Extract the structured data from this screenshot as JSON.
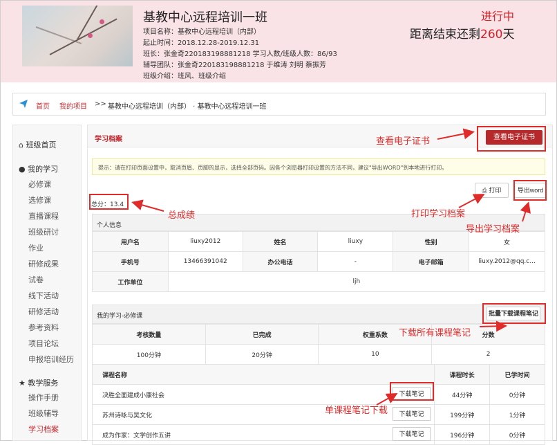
{
  "header": {
    "title": "基教中心远程培训一班",
    "project_name": "项目名称：基教中心远程培训（内部）",
    "period": "起止时间：2018.12.28-2019.12.31",
    "monitor_and_count": "班长：张金奇220183198881218      学习人数/班级人数：86/93",
    "tutors": "辅导团队：张金奇220183198881218      于维涛      刘明      蔡振芳",
    "class_intro": "班级介绍：班风、班级介绍",
    "status": "进行中",
    "countdown_prefix": "距离结束还剩",
    "countdown_days": "260",
    "countdown_suffix": "天"
  },
  "breadcrumb": {
    "home": "首页",
    "my_projects": "我的项目",
    "sep": ">>",
    "current": "基教中心远程培训（内部）  · 基教中心远程培训一班"
  },
  "sidebar": {
    "class_home": "班级首页",
    "my_study": "我的学习",
    "study_items": [
      "必修课",
      "选修课",
      "直播课程",
      "班级研讨",
      "作业",
      "研修成果",
      "试卷",
      "线下活动",
      "研修活动",
      "参考资料",
      "项目论坛",
      "申报培训经历"
    ],
    "teaching_service": "教学服务",
    "service_items": [
      "操作手册",
      "班级辅导",
      "学习档案"
    ]
  },
  "panel": {
    "title": "学习档案",
    "view_certificate": "查看电子证书",
    "tip": "提示：请在打印页面设置中，取消页眉、页脚的显示，选择全部页码。因各个浏览器打印设置的方法不同，建议\"导出WORD\"到本地进行打印。",
    "print": "打印",
    "export_word": "导出word",
    "total_score": "总分：13.4"
  },
  "personal": {
    "section_title": "个人信息",
    "labels": {
      "username": "用户名",
      "name": "姓名",
      "gender": "性别",
      "phone": "手机号",
      "office_phone": "办公电话",
      "email": "电子邮箱",
      "workplace": "工作单位"
    },
    "values": {
      "username": "liuxy2012",
      "name": "liuxy",
      "gender": "女",
      "phone": "13466391042",
      "office_phone": "-",
      "email": "liuxy.2012@qq.c...",
      "workplace": "ljh"
    }
  },
  "required": {
    "section_title": "我的学习-必修课",
    "bulk_download": "批量下载课程笔记",
    "headers": [
      "考核数量",
      "已完成",
      "权重系数",
      "分数"
    ],
    "values": [
      "100分钟",
      "20分钟",
      "10",
      "2"
    ],
    "course_headers": [
      "课程名称",
      "课程时长",
      "已学时间"
    ],
    "download_label": "下载笔记",
    "courses": [
      {
        "name": "决胜全面建成小康社会",
        "duration": "44分钟",
        "learned": "0分钟"
      },
      {
        "name": "苏州诗咏与吴文化",
        "duration": "199分钟",
        "learned": "1分钟"
      },
      {
        "name": "成为作家：文学创作五讲",
        "duration": "196分钟",
        "learned": "0分钟"
      }
    ]
  },
  "annotations": {
    "view_certificate": "查看电子证书",
    "total_score": "总成绩",
    "print_record": "打印学习档案",
    "export_record": "导出学习档案",
    "download_all_notes": "下载所有课程笔记",
    "single_note_download": "单课程笔记下载"
  },
  "colors": {
    "header_bg": "#f9e3e6",
    "accent_red": "#c0282e",
    "annotation_red": "#e02b2b"
  }
}
